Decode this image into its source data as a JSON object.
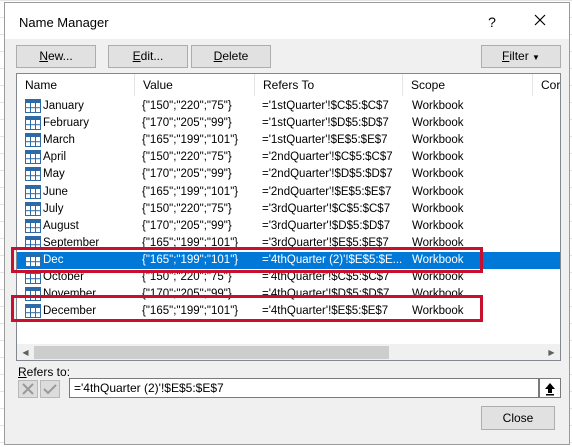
{
  "dialog": {
    "title": "Name Manager",
    "help": "?"
  },
  "toolbar": {
    "new": {
      "u": "N",
      "rest": "ew..."
    },
    "edit": {
      "u": "E",
      "rest": "dit..."
    },
    "delete": {
      "u": "D",
      "rest": "elete"
    },
    "filter": {
      "u": "F",
      "rest": "ilter"
    }
  },
  "columns": [
    "Name",
    "Value",
    "Refers To",
    "Scope",
    "Cor"
  ],
  "rows": [
    {
      "name": "January",
      "value": "{\"150\";\"220\";\"75\"}",
      "refers": "='1stQuarter'!$C$5:$C$7",
      "scope": "Workbook"
    },
    {
      "name": "February",
      "value": "{\"170\";\"205\";\"99\"}",
      "refers": "='1stQuarter'!$D$5:$D$7",
      "scope": "Workbook"
    },
    {
      "name": "March",
      "value": "{\"165\";\"199\";\"101\"}",
      "refers": "='1stQuarter'!$E$5:$E$7",
      "scope": "Workbook"
    },
    {
      "name": "April",
      "value": "{\"150\";\"220\";\"75\"}",
      "refers": "='2ndQuarter'!$C$5:$C$7",
      "scope": "Workbook"
    },
    {
      "name": "May",
      "value": "{\"170\";\"205\";\"99\"}",
      "refers": "='2ndQuarter'!$D$5:$D$7",
      "scope": "Workbook"
    },
    {
      "name": "June",
      "value": "{\"165\";\"199\";\"101\"}",
      "refers": "='2ndQuarter'!$E$5:$E$7",
      "scope": "Workbook"
    },
    {
      "name": "July",
      "value": "{\"150\";\"220\";\"75\"}",
      "refers": "='3rdQuarter'!$C$5:$C$7",
      "scope": "Workbook"
    },
    {
      "name": "August",
      "value": "{\"170\";\"205\";\"99\"}",
      "refers": "='3rdQuarter'!$D$5:$D$7",
      "scope": "Workbook"
    },
    {
      "name": "September",
      "value": "{\"165\";\"199\";\"101\"}",
      "refers": "='3rdQuarter'!$E$5:$E$7",
      "scope": "Workbook"
    },
    {
      "name": "Dec",
      "value": "{\"165\";\"199\";\"101\"}",
      "refers": "='4thQuarter (2)'!$E$5:$E...",
      "scope": "Workbook",
      "selected": true
    },
    {
      "name": "October",
      "value": "{\"150\";\"220\";\"75\"}",
      "refers": "='4thQuarter'!$C$5:$C$7",
      "scope": "Workbook"
    },
    {
      "name": "November",
      "value": "{\"170\";\"205\";\"99\"}",
      "refers": "='4thQuarter'!$D$5:$D$7",
      "scope": "Workbook"
    },
    {
      "name": "December",
      "value": "{\"165\";\"199\";\"101\"}",
      "refers": "='4thQuarter'!$E$5:$E$7",
      "scope": "Workbook"
    }
  ],
  "refers_to": {
    "u": "R",
    "rest": "efers to:",
    "value": "='4thQuarter (2)'!$E$5:$E$7"
  },
  "close": "Close",
  "colors": {
    "selection": "#0078d7",
    "highlight": "#c8102e"
  }
}
